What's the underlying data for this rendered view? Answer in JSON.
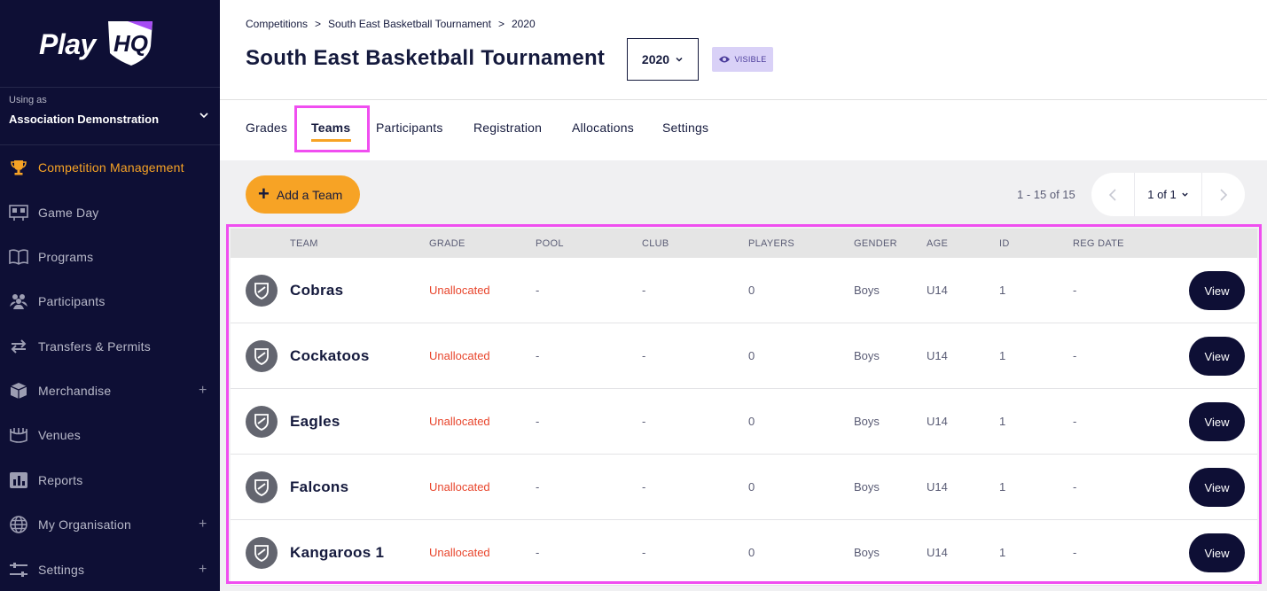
{
  "sidebar": {
    "logo": {
      "play": "Play",
      "hq": "HQ"
    },
    "using_as_label": "Using as",
    "org_name": "Association Demonstration",
    "items": [
      {
        "label": "Competition Management",
        "icon": "trophy-icon",
        "active": true
      },
      {
        "label": "Game Day",
        "icon": "scoreboard-icon"
      },
      {
        "label": "Programs",
        "icon": "book-icon"
      },
      {
        "label": "Participants",
        "icon": "people-icon"
      },
      {
        "label": "Transfers & Permits",
        "icon": "transfer-icon"
      },
      {
        "label": "Merchandise",
        "icon": "box-icon",
        "expandable": true
      },
      {
        "label": "Venues",
        "icon": "stadium-icon"
      },
      {
        "label": "Reports",
        "icon": "chart-icon"
      },
      {
        "label": "My Organisation",
        "icon": "globe-icon",
        "expandable": true
      },
      {
        "label": "Settings",
        "icon": "sliders-icon",
        "expandable": true
      }
    ],
    "plus": "+"
  },
  "breadcrumb": {
    "items": [
      "Competitions",
      "South East Basketball Tournament",
      "2020"
    ],
    "separator": ">"
  },
  "header": {
    "title": "South East Basketball Tournament",
    "year": "2020",
    "visibility": "VISIBLE"
  },
  "tabs": [
    "Grades",
    "Teams",
    "Participants",
    "Registration",
    "Allocations",
    "Settings"
  ],
  "active_tab": "Teams",
  "toolbar": {
    "add_team_label": "Add a Team",
    "plus": "+",
    "count": "1 - 15 of 15",
    "page": "1 of 1"
  },
  "table": {
    "columns": [
      "TEAM",
      "GRADE",
      "POOL",
      "CLUB",
      "PLAYERS",
      "GENDER",
      "AGE",
      "ID",
      "REG DATE"
    ],
    "rows": [
      {
        "team": "Cobras",
        "grade": "Unallocated",
        "pool": "-",
        "club": "-",
        "players": "0",
        "gender": "Boys",
        "age": "U14",
        "id": "1",
        "reg_date": "-",
        "action": "View"
      },
      {
        "team": "Cockatoos",
        "grade": "Unallocated",
        "pool": "-",
        "club": "-",
        "players": "0",
        "gender": "Boys",
        "age": "U14",
        "id": "1",
        "reg_date": "-",
        "action": "View"
      },
      {
        "team": "Eagles",
        "grade": "Unallocated",
        "pool": "-",
        "club": "-",
        "players": "0",
        "gender": "Boys",
        "age": "U14",
        "id": "1",
        "reg_date": "-",
        "action": "View"
      },
      {
        "team": "Falcons",
        "grade": "Unallocated",
        "pool": "-",
        "club": "-",
        "players": "0",
        "gender": "Boys",
        "age": "U14",
        "id": "1",
        "reg_date": "-",
        "action": "View"
      },
      {
        "team": "Kangaroos 1",
        "grade": "Unallocated",
        "pool": "-",
        "club": "-",
        "players": "0",
        "gender": "Boys",
        "age": "U14",
        "id": "1",
        "reg_date": "-",
        "action": "View"
      }
    ]
  },
  "colors": {
    "sidebar_bg": "#0e0f35",
    "accent": "#f7a325",
    "grade_red": "#e8452c",
    "highlight": "#f04ef0"
  }
}
